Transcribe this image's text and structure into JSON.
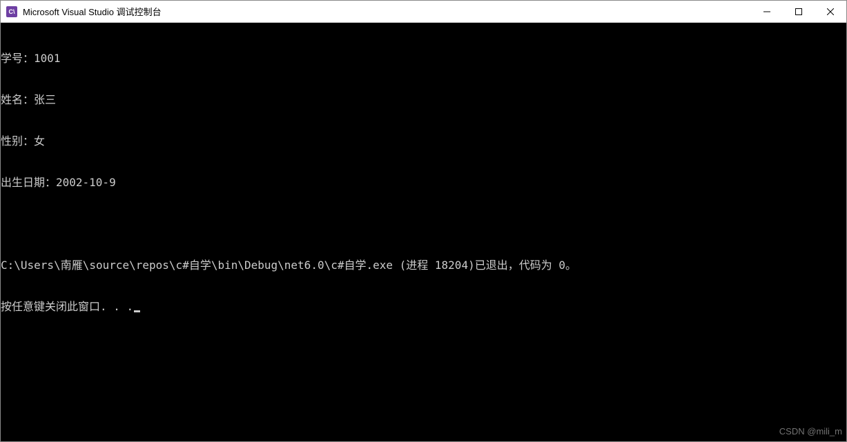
{
  "titlebar": {
    "icon_text": "C\\",
    "title": "Microsoft Visual Studio 调试控制台"
  },
  "console": {
    "lines": [
      "学号：1001",
      "姓名：张三",
      "性别：女",
      "出生日期：2002-10-9",
      "",
      "C:\\Users\\南雁\\source\\repos\\c#自学\\bin\\Debug\\net6.0\\c#自学.exe (进程 18204)已退出，代码为 0。",
      "按任意键关闭此窗口. . ."
    ]
  },
  "watermark": {
    "text": "CSDN @mili_m"
  }
}
